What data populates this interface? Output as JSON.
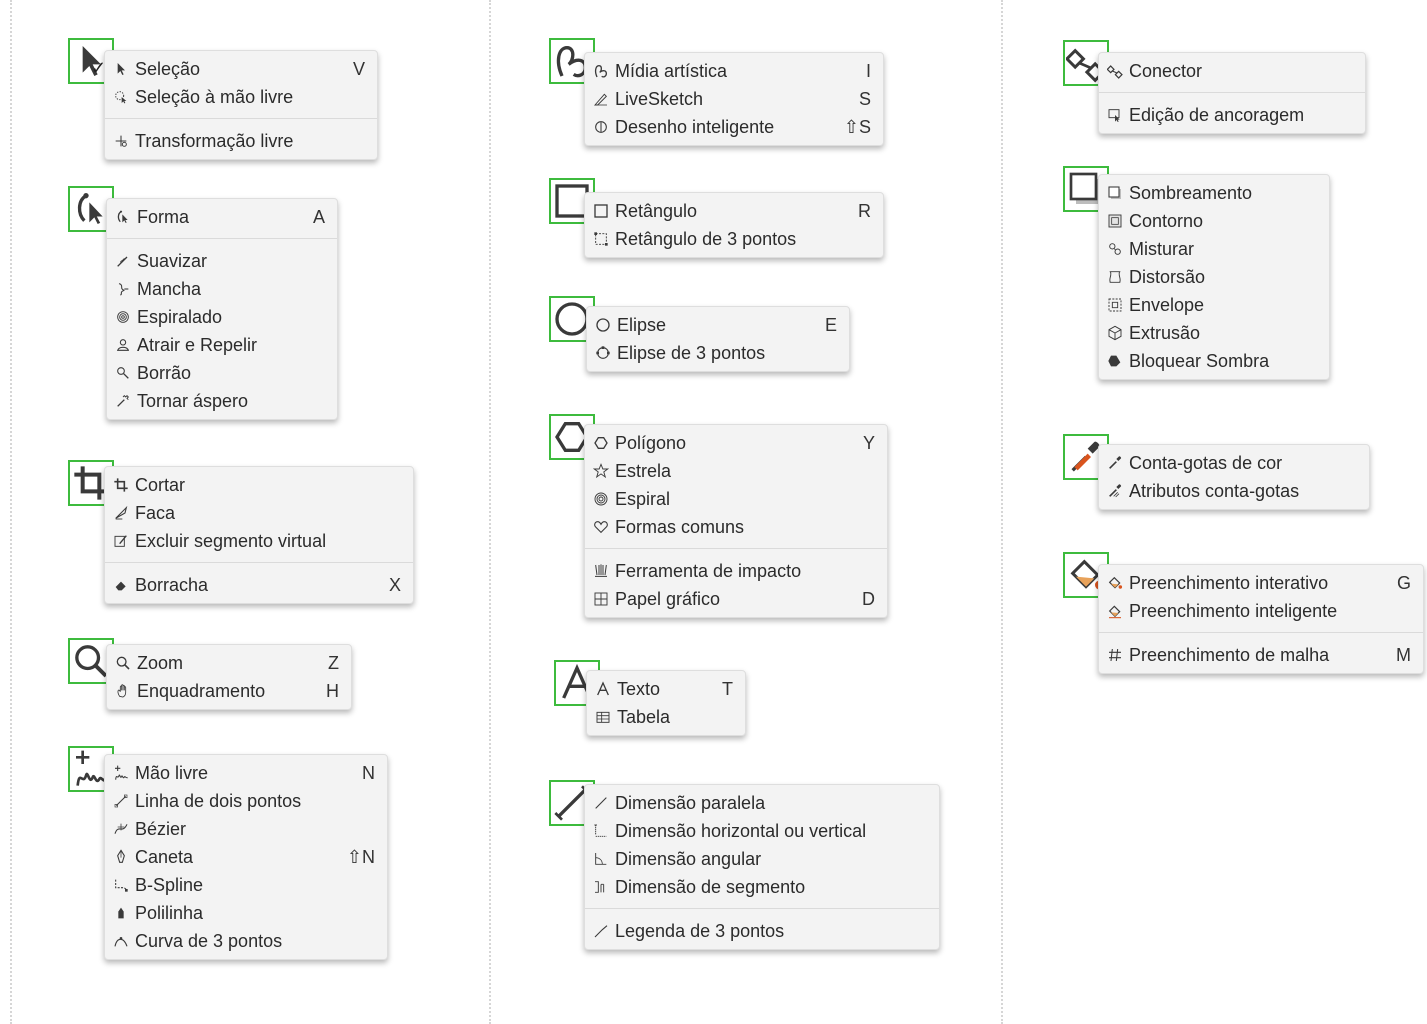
{
  "accent_color": "#3dbb3d",
  "columns": {
    "left": {
      "groups": [
        {
          "id": "selection",
          "icon": "pointer-icon",
          "items": [
            {
              "label": "Seleção",
              "shortcut": "V",
              "icon": "pointer-icon",
              "checked": true
            },
            {
              "label": "Seleção à mão livre",
              "shortcut": "",
              "icon": "freehand-pick-icon"
            },
            {
              "separator": true
            },
            {
              "label": "Transformação livre",
              "shortcut": "",
              "icon": "free-transform-icon"
            }
          ]
        },
        {
          "id": "shape",
          "icon": "shape-tool-icon",
          "items": [
            {
              "label": "Forma",
              "shortcut": "A",
              "icon": "shape-tool-icon"
            },
            {
              "separator": true
            },
            {
              "label": "Suavizar",
              "shortcut": "",
              "icon": "smooth-icon"
            },
            {
              "label": "Mancha",
              "shortcut": "",
              "icon": "smear-icon"
            },
            {
              "label": "Espiralado",
              "shortcut": "",
              "icon": "twirl-icon"
            },
            {
              "label": "Atrair e Repelir",
              "shortcut": "",
              "icon": "attract-repel-icon"
            },
            {
              "label": "Borrão",
              "shortcut": "",
              "icon": "smudge-icon"
            },
            {
              "label": "Tornar áspero",
              "shortcut": "",
              "icon": "roughen-icon"
            }
          ]
        },
        {
          "id": "crop",
          "icon": "crop-icon",
          "items": [
            {
              "label": "Cortar",
              "shortcut": "",
              "icon": "crop-icon"
            },
            {
              "label": "Faca",
              "shortcut": "",
              "icon": "knife-icon"
            },
            {
              "label": "Excluir segmento virtual",
              "shortcut": "",
              "icon": "virtual-segment-delete-icon"
            },
            {
              "separator": true
            },
            {
              "label": "Borracha",
              "shortcut": "X",
              "icon": "eraser-icon"
            }
          ]
        },
        {
          "id": "zoom",
          "icon": "zoom-icon",
          "items": [
            {
              "label": "Zoom",
              "shortcut": "Z",
              "icon": "zoom-icon"
            },
            {
              "label": "Enquadramento",
              "shortcut": "H",
              "icon": "pan-hand-icon"
            }
          ]
        },
        {
          "id": "curve",
          "icon": "freehand-curve-icon",
          "items": [
            {
              "label": "Mão livre",
              "shortcut": "N",
              "icon": "freehand-curve-icon"
            },
            {
              "label": "Linha de dois pontos",
              "shortcut": "",
              "icon": "two-point-line-icon"
            },
            {
              "label": "Bézier",
              "shortcut": "",
              "icon": "bezier-icon"
            },
            {
              "label": "Caneta",
              "shortcut": "⇧N",
              "icon": "pen-icon"
            },
            {
              "label": "B-Spline",
              "shortcut": "",
              "icon": "bspline-icon"
            },
            {
              "label": "Polilinha",
              "shortcut": "",
              "icon": "polyline-icon"
            },
            {
              "label": "Curva de 3 pontos",
              "shortcut": "",
              "icon": "three-point-curve-icon"
            }
          ]
        }
      ]
    },
    "middle": {
      "groups": [
        {
          "id": "artistic",
          "icon": "artistic-media-icon",
          "items": [
            {
              "label": "Mídia artística",
              "shortcut": "I",
              "icon": "artistic-media-icon"
            },
            {
              "label": "LiveSketch",
              "shortcut": "S",
              "icon": "livesketch-icon"
            },
            {
              "label": "Desenho inteligente",
              "shortcut": "⇧S",
              "icon": "smart-drawing-icon"
            }
          ]
        },
        {
          "id": "rectangle",
          "icon": "rectangle-icon",
          "items": [
            {
              "label": "Retângulo",
              "shortcut": "R",
              "icon": "rectangle-icon"
            },
            {
              "label": "Retângulo de 3 pontos",
              "shortcut": "",
              "icon": "three-point-rectangle-icon"
            }
          ]
        },
        {
          "id": "ellipse",
          "icon": "ellipse-icon",
          "items": [
            {
              "label": "Elipse",
              "shortcut": "E",
              "icon": "ellipse-icon"
            },
            {
              "label": "Elipse de 3 pontos",
              "shortcut": "",
              "icon": "three-point-ellipse-icon"
            }
          ]
        },
        {
          "id": "polygon",
          "icon": "polygon-icon",
          "items": [
            {
              "label": "Polígono",
              "shortcut": "Y",
              "icon": "polygon-icon"
            },
            {
              "label": "Estrela",
              "shortcut": "",
              "icon": "star-icon"
            },
            {
              "label": "Espiral",
              "shortcut": "",
              "icon": "spiral-icon"
            },
            {
              "label": "Formas comuns",
              "shortcut": "",
              "icon": "heart-icon"
            },
            {
              "separator": true
            },
            {
              "label": "Ferramenta de impacto",
              "shortcut": "",
              "icon": "impact-tool-icon"
            },
            {
              "label": "Papel gráfico",
              "shortcut": "D",
              "icon": "graph-paper-icon"
            }
          ]
        },
        {
          "id": "text",
          "icon": "text-icon",
          "items": [
            {
              "label": "Texto",
              "shortcut": "T",
              "icon": "text-icon"
            },
            {
              "label": "Tabela",
              "shortcut": "",
              "icon": "table-icon"
            }
          ]
        },
        {
          "id": "dimension",
          "icon": "dimension-line-icon",
          "items": [
            {
              "label": "Dimensão paralela",
              "shortcut": "",
              "icon": "parallel-dimension-icon"
            },
            {
              "label": "Dimensão horizontal ou vertical",
              "shortcut": "",
              "icon": "horizontal-vertical-dimension-icon"
            },
            {
              "label": "Dimensão angular",
              "shortcut": "",
              "icon": "angular-dimension-icon"
            },
            {
              "label": "Dimensão de segmento",
              "shortcut": "",
              "icon": "segment-dimension-icon"
            },
            {
              "separator": true
            },
            {
              "label": "Legenda de 3 pontos",
              "shortcut": "",
              "icon": "three-point-callout-icon"
            }
          ]
        }
      ]
    },
    "right": {
      "groups": [
        {
          "id": "connector",
          "icon": "connector-icon",
          "items": [
            {
              "label": "Conector",
              "shortcut": "",
              "icon": "connector-icon"
            },
            {
              "separator": true
            },
            {
              "label": "Edição de ancoragem",
              "shortcut": "",
              "icon": "anchor-edit-icon"
            }
          ]
        },
        {
          "id": "effects",
          "icon": "drop-shadow-icon",
          "items": [
            {
              "label": "Sombreamento",
              "shortcut": "",
              "icon": "drop-shadow-icon"
            },
            {
              "label": "Contorno",
              "shortcut": "",
              "icon": "contour-icon"
            },
            {
              "label": "Misturar",
              "shortcut": "",
              "icon": "blend-icon"
            },
            {
              "label": "Distorsão",
              "shortcut": "",
              "icon": "distort-icon"
            },
            {
              "label": "Envelope",
              "shortcut": "",
              "icon": "envelope-icon"
            },
            {
              "label": "Extrusão",
              "shortcut": "",
              "icon": "extrude-icon"
            },
            {
              "label": "Bloquear Sombra",
              "shortcut": "",
              "icon": "block-shadow-icon"
            }
          ]
        },
        {
          "id": "eyedropper",
          "icon": "eyedropper-icon",
          "items": [
            {
              "label": "Conta-gotas de cor",
              "shortcut": "",
              "icon": "color-eyedropper-icon"
            },
            {
              "label": "Atributos conta-gotas",
              "shortcut": "",
              "icon": "attributes-eyedropper-icon"
            }
          ]
        },
        {
          "id": "fill",
          "icon": "interactive-fill-icon",
          "items": [
            {
              "label": "Preenchimento interativo",
              "shortcut": "G",
              "icon": "interactive-fill-icon"
            },
            {
              "label": "Preenchimento inteligente",
              "shortcut": "",
              "icon": "smart-fill-icon"
            },
            {
              "separator": true
            },
            {
              "label": "Preenchimento de malha",
              "shortcut": "M",
              "icon": "mesh-fill-icon"
            }
          ]
        }
      ]
    }
  }
}
